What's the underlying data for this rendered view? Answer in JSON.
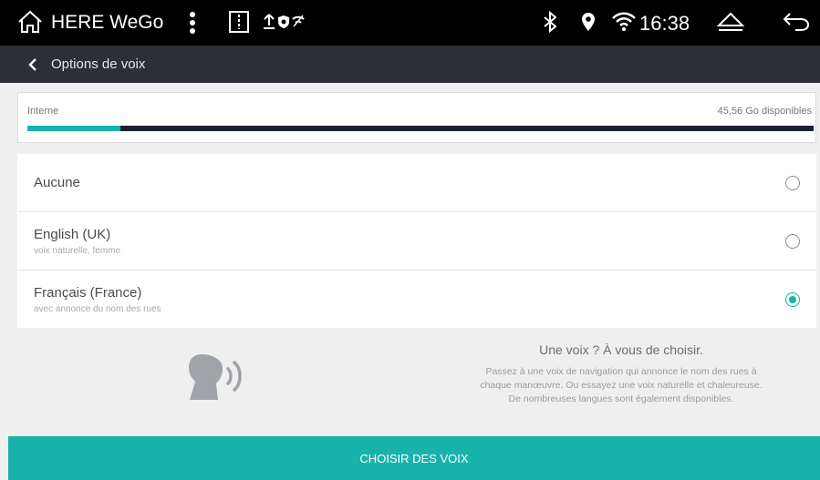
{
  "status_bar": {
    "home_icon": "home-outline-icon",
    "app_title": "HERE WeGo",
    "menu_icon": "vertical-dots-icon",
    "time": "16:38",
    "icons": [
      "bluetooth-icon",
      "location-pin-icon",
      "wifi-icon",
      "eject-icon",
      "back-arrow-icon"
    ]
  },
  "app_bar": {
    "back_icon": "chevron-left-icon",
    "title": "Options de voix"
  },
  "storage": {
    "label": "Interne",
    "free_space": "45,56 Go disponibles",
    "used_fraction": 0.118,
    "fill_color": "#17b3aa"
  },
  "voices": [
    {
      "name": "Aucune",
      "description": "",
      "selected": false
    },
    {
      "name": "English (UK)",
      "description": "voix naturelle, femme",
      "selected": false
    },
    {
      "name": "Français (France)",
      "description": "avec annonce du nom des rues",
      "selected": true
    }
  ],
  "promo": {
    "icon": "speaking-person-icon",
    "title": "Une voix ? À vous de choisir.",
    "line1": "Passez à une voix de navigation qui annonce le nom des rues à",
    "line2": "chaque manœuvre. Ou essayez une voix naturelle et chaleureuse.",
    "line3": "De nombreuses langues sont également disponibles."
  },
  "cta": {
    "label": "CHOISIR DES VOIX",
    "color": "#17b3aa"
  }
}
